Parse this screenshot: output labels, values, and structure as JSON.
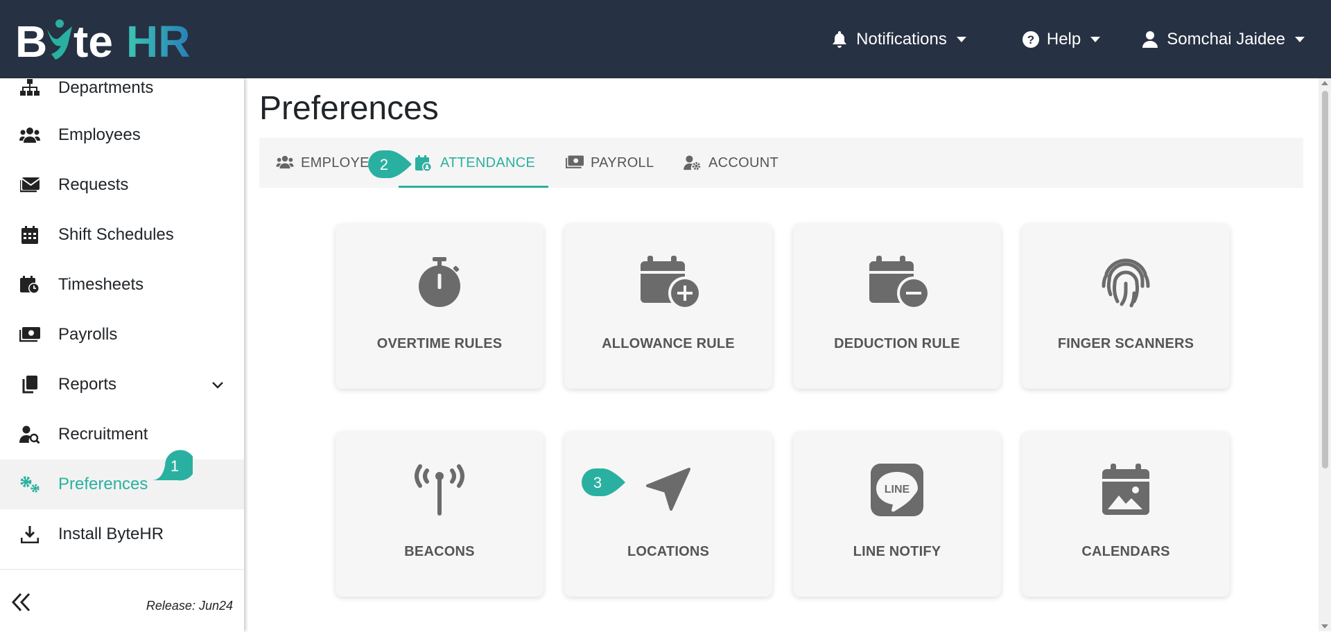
{
  "brand": {
    "name": "ByteHR",
    "color": "#2ab0a0"
  },
  "topbar": {
    "notifications": {
      "label": "Notifications",
      "icon": "bell-icon"
    },
    "help": {
      "label": "Help",
      "icon": "question-circle-icon"
    },
    "user": {
      "label": "Somchai Jaidee",
      "icon": "user-icon"
    }
  },
  "sidebar": {
    "items": [
      {
        "label": "Departments",
        "icon": "sitemap-icon"
      },
      {
        "label": "Employees",
        "icon": "users-icon"
      },
      {
        "label": "Requests",
        "icon": "envelope-icon"
      },
      {
        "label": "Shift Schedules",
        "icon": "calendar-icon"
      },
      {
        "label": "Timesheets",
        "icon": "calendar-clock-icon"
      },
      {
        "label": "Payrolls",
        "icon": "money-bill-icon"
      },
      {
        "label": "Reports",
        "icon": "copy-icon"
      },
      {
        "label": "Recruitment",
        "icon": "user-search-icon"
      },
      {
        "label": "Preferences",
        "icon": "gears-icon",
        "active": true
      },
      {
        "label": "Install ByteHR",
        "icon": "download-icon"
      }
    ],
    "release": "Release: Jun24"
  },
  "main": {
    "title": "Preferences",
    "tabs": [
      {
        "label": "EMPLOYEE",
        "icon": "users-icon"
      },
      {
        "label": "ATTENDANCE",
        "icon": "calendar-user-icon",
        "active": true
      },
      {
        "label": "PAYROLL",
        "icon": "money-bill-icon"
      },
      {
        "label": "ACCOUNT",
        "icon": "user-gear-icon"
      }
    ],
    "cards": [
      {
        "label": "OVERTIME RULES",
        "icon": "stopwatch-icon"
      },
      {
        "label": "ALLOWANCE RULE",
        "icon": "calendar-plus-icon"
      },
      {
        "label": "DEDUCTION RULE",
        "icon": "calendar-minus-icon"
      },
      {
        "label": "FINGER SCANNERS",
        "icon": "fingerprint-icon"
      },
      {
        "label": "BEACONS",
        "icon": "tower-broadcast-icon"
      },
      {
        "label": "LOCATIONS",
        "icon": "location-arrow-icon"
      },
      {
        "label": "LINE NOTIFY",
        "icon": "line-icon",
        "icon_text": "LINE"
      },
      {
        "label": "CALENDARS",
        "icon": "calendar-image-icon"
      }
    ]
  },
  "markers": [
    "1",
    "2",
    "3"
  ],
  "colors": {
    "topbar": "#263143",
    "accent": "#2ab0a0",
    "icon": "#6b6b6b"
  }
}
